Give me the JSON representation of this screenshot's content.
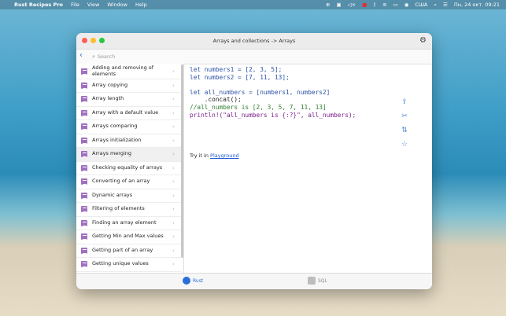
{
  "menubar": {
    "app": "Rust Recipes Pro",
    "menus": [
      "File",
      "View",
      "Window",
      "Help"
    ],
    "input_source": "США",
    "clock": "Пн, 24 окт. 09:21"
  },
  "window": {
    "title": "Arrays and collections -> Arrays",
    "search_placeholder": "Search"
  },
  "sidebar": {
    "items": [
      {
        "label": "Adding and removing of elements"
      },
      {
        "label": "Array copying"
      },
      {
        "label": "Array length"
      },
      {
        "label": "Array with a default value"
      },
      {
        "label": "Arrays comparing"
      },
      {
        "label": "Arrays initialization"
      },
      {
        "label": "Arrays merging"
      },
      {
        "label": "Checking equality of arrays"
      },
      {
        "label": "Converting of an array"
      },
      {
        "label": "Dynamic arrays"
      },
      {
        "label": "Filtering of elements"
      },
      {
        "label": "Finding an array element"
      },
      {
        "label": "Getting Min and Max values"
      },
      {
        "label": "Getting part of an array"
      },
      {
        "label": "Getting unique values"
      },
      {
        "label": "..."
      }
    ],
    "selected_index": 6
  },
  "code": {
    "line1": "let numbers1 = [2, 3, 5];",
    "line2": "let numbers2 = [7, 11, 13];",
    "line3": "let all_numbers = [numbers1, numbers2]",
    "line4": "    .concat();",
    "line5": "//all_numbers is [2, 3, 5, 7, 11, 13]",
    "line6": "println!(\"all_numbers is {:?}\", all_numbers);"
  },
  "try_it": {
    "prefix": "Try it in",
    "link": "Playground"
  },
  "tabs": {
    "rust": "Rust",
    "sql": "SQL"
  },
  "colors": {
    "accent": "#2b6fd6",
    "recipe_icon": "#a070c0"
  }
}
